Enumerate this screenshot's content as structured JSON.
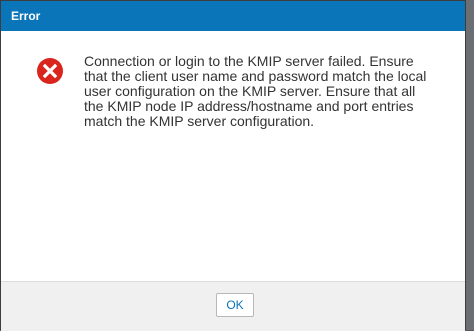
{
  "dialog": {
    "title": "Error",
    "message": "Connection or login to the KMIP server failed. Ensure that the client user name and password match the local user configuration on the KMIP server. Ensure that all the KMIP node IP address/hostname and port entries match the KMIP server configuration.",
    "icon": "error-icon",
    "ok_label": "OK"
  },
  "colors": {
    "title_bar": "#0a75b8",
    "error_icon": "#d9251d",
    "footer": "#f0f0f0"
  }
}
